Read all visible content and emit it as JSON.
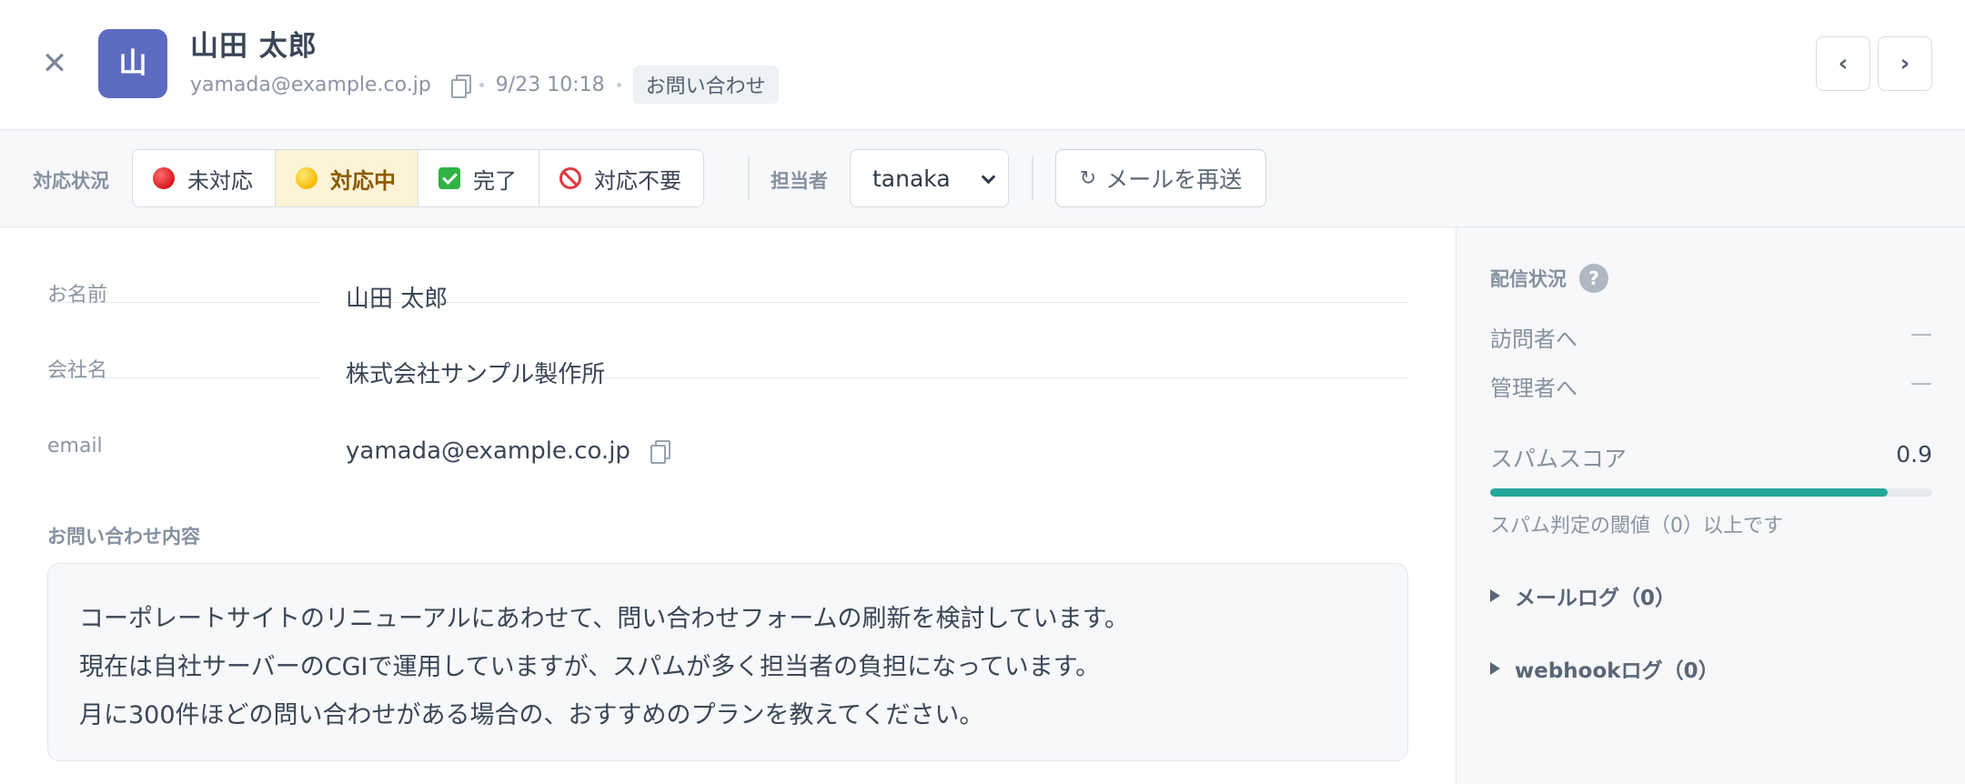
{
  "header": {
    "close_symbol": "✕",
    "avatar_initial": "山",
    "name": "山田 太郎",
    "email": "yamada@example.co.jp",
    "datetime": "9/23 10:18",
    "tag": "お問い合わせ",
    "prev_symbol": "‹",
    "next_symbol": "›",
    "avatar_color": "#5c6bc0"
  },
  "toolbar": {
    "status_label": "対応状況",
    "statuses": [
      {
        "label": "未対応",
        "icon": "red-circle-icon"
      },
      {
        "label": "対応中",
        "icon": "yellow-circle-icon",
        "active": true
      },
      {
        "label": "完了",
        "icon": "check-mark-icon"
      },
      {
        "label": "対応不要",
        "icon": "no-entry-icon"
      }
    ],
    "assignee_label": "担当者",
    "assignee_value": "tanaka",
    "resend_label": "メールを再送",
    "active_color": "#fdf3d6"
  },
  "main": {
    "fields": [
      {
        "label": "お名前",
        "value": "山田 太郎"
      },
      {
        "label": "会社名",
        "value": "株式会社サンプル製作所"
      },
      {
        "label": "email",
        "value": "yamada@example.co.jp"
      }
    ],
    "inquiry_heading": "お問い合わせ内容",
    "message_lines": [
      "コーポレートサイトのリニューアルにあわせて、問い合わせフォームの刷新を検討しています。",
      "現在は自社サーバーのCGIで運用していますが、スパムが多く担当者の負担になっています。",
      "月に300件ほどの問い合わせがある場合の、おすすめのプランを教えてください。"
    ]
  },
  "sidebar": {
    "delivery_heading": "配信状況",
    "help_symbol": "?",
    "to_visitor_label": "訪問者へ",
    "to_visitor_value": "—",
    "to_admin_label": "管理者へ",
    "to_admin_value": "—",
    "spam_label": "スパムスコア",
    "spam_score": "0.9",
    "spam_fill_fraction": 0.9,
    "spam_note": "スパム判定の閾値（0）以上です",
    "mail_log_label": "メールログ（0）",
    "webhook_log_label": "webhookログ（0）",
    "progress_color": "#26a69a"
  }
}
